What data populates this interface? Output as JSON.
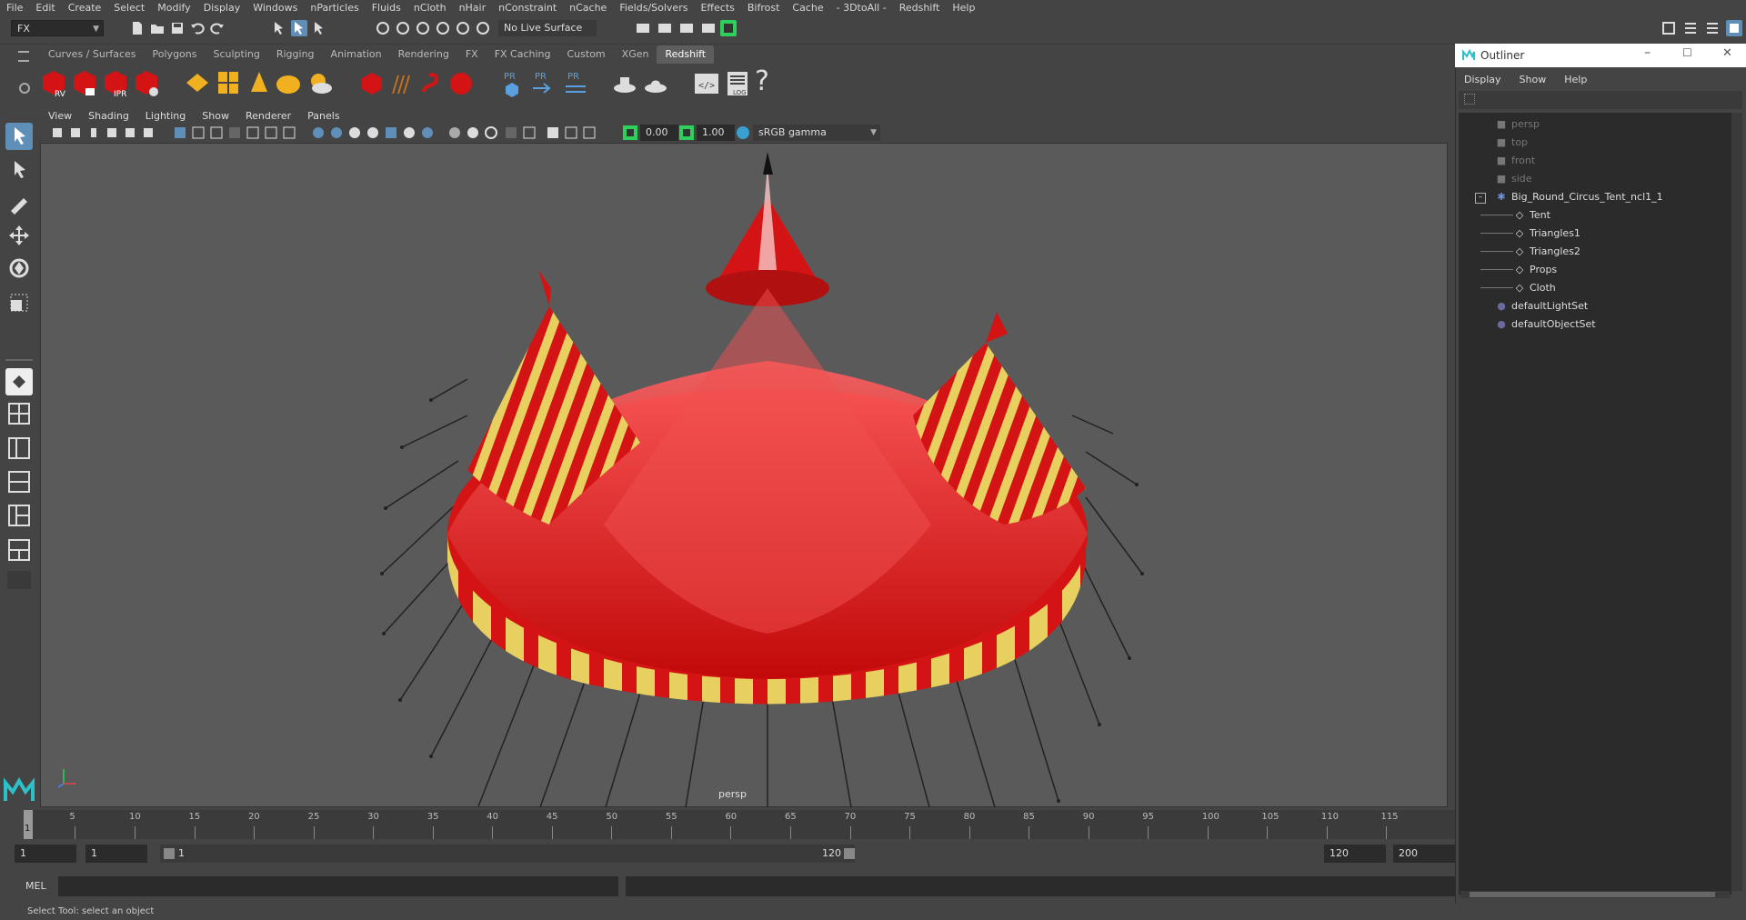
{
  "menubar": [
    "File",
    "Edit",
    "Create",
    "Select",
    "Modify",
    "Display",
    "Windows",
    "nParticles",
    "Fluids",
    "nCloth",
    "nHair",
    "nConstraint",
    "nCache",
    "Fields/Solvers",
    "Effects",
    "Bifrost",
    "Cache",
    "- 3DtoAll -",
    "Redshift",
    "Help"
  ],
  "status": {
    "menuset": "FX",
    "live_surface": "No Live Surface"
  },
  "shelf_tabs": [
    {
      "label": "Curves / Surfaces",
      "active": false
    },
    {
      "label": "Polygons",
      "active": false
    },
    {
      "label": "Sculpting",
      "active": false
    },
    {
      "label": "Rigging",
      "active": false
    },
    {
      "label": "Animation",
      "active": false
    },
    {
      "label": "Rendering",
      "active": false
    },
    {
      "label": "FX",
      "active": false
    },
    {
      "label": "FX Caching",
      "active": false
    },
    {
      "label": "Custom",
      "active": false
    },
    {
      "label": "XGen",
      "active": false
    },
    {
      "label": "Redshift",
      "active": true
    }
  ],
  "shelf_icon_labels": {
    "rv": "RV",
    "ipr": "IPR",
    "pr": "PR",
    "log": "LOG",
    "help": "?"
  },
  "viewport": {
    "menu": [
      "View",
      "Shading",
      "Lighting",
      "Show",
      "Renderer",
      "Panels"
    ],
    "exposure": "0.00",
    "gamma": "1.00",
    "colorspace": "sRGB gamma",
    "camera": "persp"
  },
  "timeline": {
    "ticks": [
      "5",
      "10",
      "15",
      "20",
      "25",
      "30",
      "35",
      "40",
      "45",
      "50",
      "55",
      "60",
      "65",
      "70",
      "75",
      "80",
      "85",
      "90",
      "95",
      "100",
      "105",
      "110",
      "115"
    ],
    "current": "1",
    "start": "1",
    "playback_start": "1",
    "range_start": "1",
    "range_end": "120",
    "playback_end": "120",
    "end": "200"
  },
  "mel_label": "MEL",
  "status_message": "Select Tool: select an object",
  "outliner": {
    "title": "Outliner",
    "menu": [
      "Display",
      "Show",
      "Help"
    ],
    "items": [
      {
        "label": "persp",
        "type": "camera",
        "indent": 0,
        "dim": true
      },
      {
        "label": "top",
        "type": "camera",
        "indent": 0,
        "dim": true
      },
      {
        "label": "front",
        "type": "camera",
        "indent": 0,
        "dim": true
      },
      {
        "label": "side",
        "type": "camera",
        "indent": 0,
        "dim": true
      },
      {
        "label": "Big_Round_Circus_Tent_ncl1_1",
        "type": "group",
        "indent": 0,
        "dim": false
      },
      {
        "label": "Tent",
        "type": "mesh",
        "indent": 1,
        "dim": false
      },
      {
        "label": "Triangles1",
        "type": "mesh",
        "indent": 1,
        "dim": false
      },
      {
        "label": "Triangles2",
        "type": "mesh",
        "indent": 1,
        "dim": false
      },
      {
        "label": "Props",
        "type": "mesh",
        "indent": 1,
        "dim": false
      },
      {
        "label": "Cloth",
        "type": "mesh",
        "indent": 1,
        "dim": false
      },
      {
        "label": "defaultLightSet",
        "type": "set",
        "indent": 0,
        "dim": false
      },
      {
        "label": "defaultObjectSet",
        "type": "set",
        "indent": 0,
        "dim": false
      }
    ]
  },
  "colors": {
    "tent_red": "#d41414",
    "tent_yellow": "#e8d060",
    "accent_green": "#2fd05a",
    "selection_blue": "#5f8fb8"
  }
}
